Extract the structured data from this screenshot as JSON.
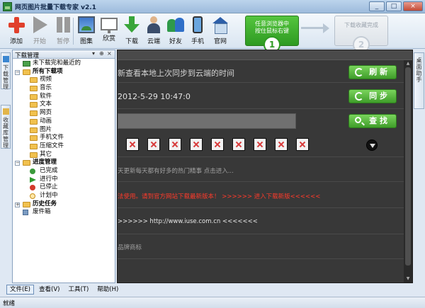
{
  "window": {
    "title": "网页图片批量下载专家 v2.1"
  },
  "toolbar": {
    "items": [
      {
        "label": "添加",
        "icon": "add-icon"
      },
      {
        "label": "开始",
        "icon": "play-icon"
      },
      {
        "label": "暂停",
        "icon": "pause-icon"
      },
      {
        "label": "图集",
        "icon": "album-icon"
      },
      {
        "label": "欣赏",
        "icon": "monitor-icon"
      },
      {
        "label": "下载",
        "icon": "download-arrow-icon"
      },
      {
        "label": "云端",
        "icon": "cloud-user-icon"
      },
      {
        "label": "好友",
        "icon": "friends-icon"
      },
      {
        "label": "手机",
        "icon": "phone-icon"
      },
      {
        "label": "官网",
        "icon": "home-icon"
      }
    ],
    "step1": {
      "line1": "任意浏览器中",
      "line2": "按住鼠标右键",
      "number": "1"
    },
    "step2": {
      "label": "下载收藏完成",
      "number": "2"
    }
  },
  "left_tabs": [
    "下载管理",
    "收藏库管理"
  ],
  "right_tab": "桌面助手",
  "panel": {
    "title": "下载管理",
    "controls": [
      "▾",
      "⊕",
      "×"
    ]
  },
  "tree": [
    {
      "label": "未下载完和最近的",
      "level": 1,
      "icon": "recent-icon"
    },
    {
      "label": "所有下载项",
      "level": 0,
      "bold": true,
      "expander": "−",
      "icon": "folder-icon"
    },
    {
      "label": "视频",
      "level": 2,
      "icon": "folder-icon"
    },
    {
      "label": "音乐",
      "level": 2,
      "icon": "folder-icon"
    },
    {
      "label": "软件",
      "level": 2,
      "icon": "folder-icon"
    },
    {
      "label": "文本",
      "level": 2,
      "icon": "folder-icon"
    },
    {
      "label": "网页",
      "level": 2,
      "icon": "folder-icon"
    },
    {
      "label": "动画",
      "level": 2,
      "icon": "folder-icon"
    },
    {
      "label": "图片",
      "level": 2,
      "icon": "folder-icon"
    },
    {
      "label": "手机文件",
      "level": 2,
      "icon": "folder-icon"
    },
    {
      "label": "压缩文件",
      "level": 2,
      "icon": "folder-icon"
    },
    {
      "label": "其它",
      "level": 2,
      "icon": "folder-icon"
    },
    {
      "label": "进度管理",
      "level": 0,
      "bold": true,
      "expander": "−",
      "icon": "folder-icon"
    },
    {
      "label": "已完成",
      "level": 2,
      "icon": "done-icon"
    },
    {
      "label": "进行中",
      "level": 2,
      "icon": "running-icon"
    },
    {
      "label": "已停止",
      "level": 2,
      "icon": "stopped-icon"
    },
    {
      "label": "计划中",
      "level": 2,
      "icon": "planned-icon"
    },
    {
      "label": "历史任务",
      "level": 0,
      "bold": true,
      "expander": "+",
      "icon": "folder-icon"
    },
    {
      "label": "废件箱",
      "level": 1,
      "icon": "trash-icon"
    }
  ],
  "content": {
    "sync_text": "新查看本地上次同步到云端的时间",
    "sync_time": "2012-5-29 10:47:0",
    "refresh_label": "刷 新",
    "sync_label": "同 步",
    "search_label": "查 找",
    "news_text": "天更新每天都有好多的热门精事 点击进入...",
    "warning_text": "法使用。请到官方网站下载最新版本！ >>>>>> 进入下载新版<<<<<<",
    "url_text": ">>>>>> http://www.iuse.com.cn <<<<<<<",
    "brand_text": "品牌商标"
  },
  "menu": [
    "文件(E)",
    "查看(V)",
    "工具(T)",
    "帮助(H)"
  ],
  "status": "就绪"
}
